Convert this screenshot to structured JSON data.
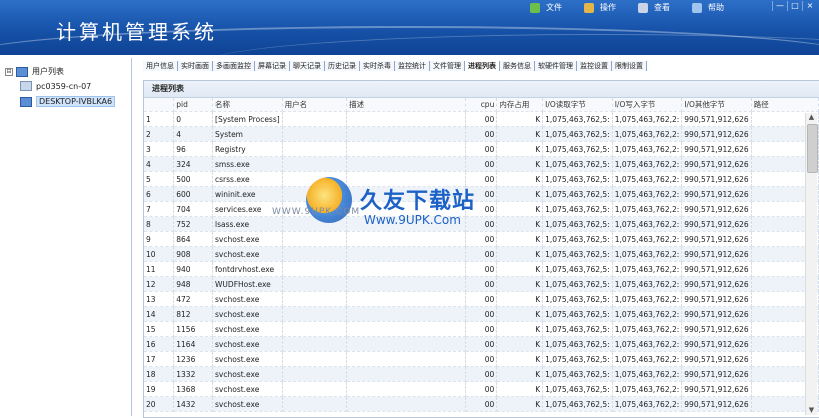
{
  "app": {
    "title": "计算机管理系统"
  },
  "topmenu": [
    {
      "label": "文件",
      "icon": "file-icon",
      "color": "#6bbf4a"
    },
    {
      "label": "操作",
      "icon": "wrench-icon",
      "color": "#e2b64a"
    },
    {
      "label": "查看",
      "icon": "view-icon",
      "color": "#c9d4e6"
    },
    {
      "label": "帮助",
      "icon": "help-icon",
      "color": "#9fc4ee"
    }
  ],
  "window_controls": [
    "—",
    "□",
    "×"
  ],
  "tree": {
    "root": {
      "toggle": "⊟",
      "label": "用户列表"
    },
    "children": [
      {
        "label": "pc0359-cn-07",
        "selected": false
      },
      {
        "label": "DESKTOP-IVBLKA6",
        "selected": true
      }
    ]
  },
  "tabs": [
    "用户信息",
    "实时画面",
    "多画面监控",
    "屏幕记录",
    "聊天记录",
    "历史记录",
    "实时杀毒",
    "监控统计",
    "文件管理",
    "进程列表",
    "服务信息",
    "软硬件管理",
    "监控设置",
    "限制设置"
  ],
  "active_tab": "进程列表",
  "panel": {
    "title": "进程列表"
  },
  "table": {
    "headers": [
      "",
      "pid",
      "名称",
      "用户名",
      "描述",
      "cpu",
      "内存占用",
      "I/O读取字节",
      "I/O写入字节",
      "I/O其他字节",
      "路径"
    ],
    "rows": [
      [
        "1",
        "0",
        "[System Process]",
        "",
        "",
        "00",
        "K",
        "1,075,463,762,5:",
        "1,075,463,762,2:",
        "990,571,912,626",
        ""
      ],
      [
        "2",
        "4",
        "System",
        "",
        "",
        "00",
        "K",
        "1,075,463,762,5:",
        "1,075,463,762,2:",
        "990,571,912,626",
        ""
      ],
      [
        "3",
        "96",
        "Registry",
        "",
        "",
        "00",
        "K",
        "1,075,463,762,5:",
        "1,075,463,762,2:",
        "990,571,912,626",
        ""
      ],
      [
        "4",
        "324",
        "smss.exe",
        "",
        "",
        "00",
        "K",
        "1,075,463,762,5:",
        "1,075,463,762,2:",
        "990,571,912,626",
        ""
      ],
      [
        "5",
        "500",
        "csrss.exe",
        "",
        "",
        "00",
        "K",
        "1,075,463,762,5:",
        "1,075,463,762,2:",
        "990,571,912,626",
        ""
      ],
      [
        "6",
        "600",
        "wininit.exe",
        "",
        "",
        "00",
        "K",
        "1,075,463,762,5:",
        "1,075,463,762,2:",
        "990,571,912,626",
        ""
      ],
      [
        "7",
        "704",
        "services.exe",
        "",
        "",
        "00",
        "K",
        "1,075,463,762,5:",
        "1,075,463,762,2:",
        "990,571,912,626",
        ""
      ],
      [
        "8",
        "752",
        "lsass.exe",
        "",
        "",
        "00",
        "K",
        "1,075,463,762,5:",
        "1,075,463,762,2:",
        "990,571,912,626",
        ""
      ],
      [
        "9",
        "864",
        "svchost.exe",
        "",
        "",
        "00",
        "K",
        "1,075,463,762,5:",
        "1,075,463,762,2:",
        "990,571,912,626",
        ""
      ],
      [
        "10",
        "908",
        "svchost.exe",
        "",
        "",
        "00",
        "K",
        "1,075,463,762,5:",
        "1,075,463,762,2:",
        "990,571,912,626",
        ""
      ],
      [
        "11",
        "940",
        "fontdrvhost.exe",
        "",
        "",
        "00",
        "K",
        "1,075,463,762,5:",
        "1,075,463,762,2:",
        "990,571,912,626",
        ""
      ],
      [
        "12",
        "948",
        "WUDFHost.exe",
        "",
        "",
        "00",
        "K",
        "1,075,463,762,5:",
        "1,075,463,762,2:",
        "990,571,912,626",
        ""
      ],
      [
        "13",
        "472",
        "svchost.exe",
        "",
        "",
        "00",
        "K",
        "1,075,463,762,5:",
        "1,075,463,762,2:",
        "990,571,912,626",
        ""
      ],
      [
        "14",
        "812",
        "svchost.exe",
        "",
        "",
        "00",
        "K",
        "1,075,463,762,5:",
        "1,075,463,762,2:",
        "990,571,912,626",
        ""
      ],
      [
        "15",
        "1156",
        "svchost.exe",
        "",
        "",
        "00",
        "K",
        "1,075,463,762,5:",
        "1,075,463,762,2:",
        "990,571,912,626",
        ""
      ],
      [
        "16",
        "1164",
        "svchost.exe",
        "",
        "",
        "00",
        "K",
        "1,075,463,762,5:",
        "1,075,463,762,2:",
        "990,571,912,626",
        ""
      ],
      [
        "17",
        "1236",
        "svchost.exe",
        "",
        "",
        "00",
        "K",
        "1,075,463,762,5:",
        "1,075,463,762,2:",
        "990,571,912,626",
        ""
      ],
      [
        "18",
        "1332",
        "svchost.exe",
        "",
        "",
        "00",
        "K",
        "1,075,463,762,5:",
        "1,075,463,762,2:",
        "990,571,912,626",
        ""
      ],
      [
        "19",
        "1368",
        "svchost.exe",
        "",
        "",
        "00",
        "K",
        "1,075,463,762,5:",
        "1,075,463,762,2:",
        "990,571,912,626",
        ""
      ],
      [
        "20",
        "1432",
        "svchost.exe",
        "",
        "",
        "00",
        "K",
        "1,075,463,762,5:",
        "1,075,463,762,2:",
        "990,571,912,626",
        ""
      ]
    ]
  },
  "watermark": {
    "brand": "久友下载站",
    "site_left": "WWW.9UPK.COM",
    "site_right": "Www.9UPK.Com"
  }
}
